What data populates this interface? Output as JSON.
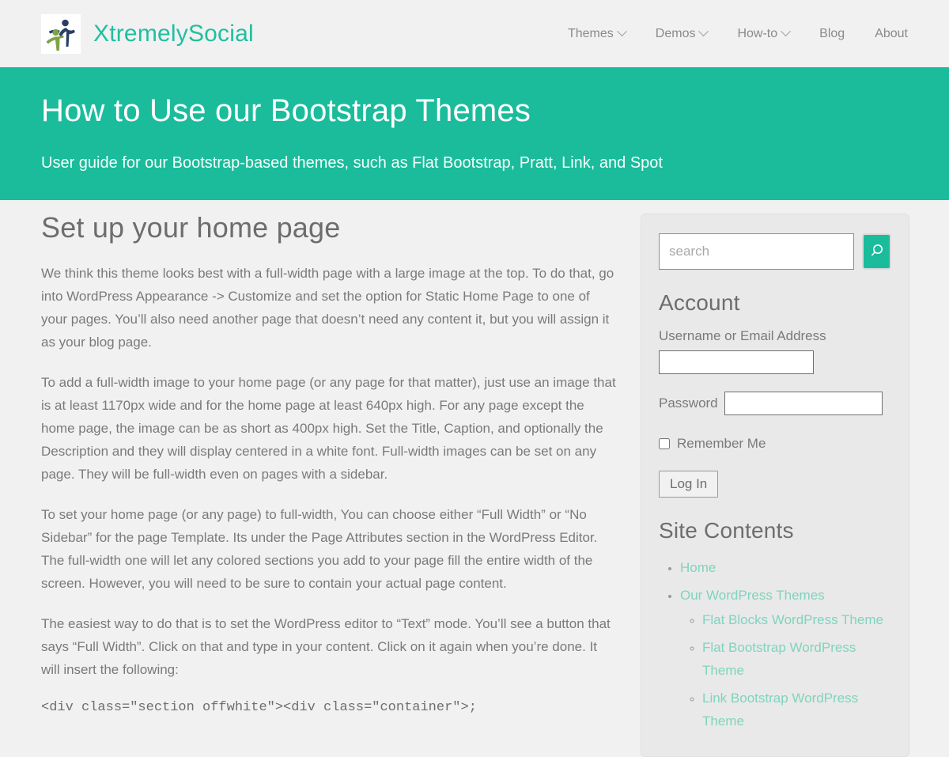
{
  "brand": {
    "name": "XtremelySocial",
    "logo_icon": "two-figures-logo-icon"
  },
  "nav": {
    "items": [
      {
        "label": "Themes",
        "has_dropdown": true
      },
      {
        "label": "Demos",
        "has_dropdown": true
      },
      {
        "label": "How-to",
        "has_dropdown": true
      },
      {
        "label": "Blog",
        "has_dropdown": false
      },
      {
        "label": "About",
        "has_dropdown": false
      }
    ]
  },
  "hero": {
    "title": "How to Use our Bootstrap Themes",
    "subtitle": "User guide for our Bootstrap-based themes, such as Flat Bootstrap, Pratt, Link, and Spot",
    "background_color": "#1abc9c"
  },
  "content": {
    "title": "Set up your home page",
    "paragraphs": [
      "We think this theme looks best with a full-width page with a large image at the top. To do that, go into WordPress Appearance -> Customize and set the option for Static Home Page to one of your pages. You’ll also need another page that doesn’t need any content it, but you will assign it as your blog page.",
      "To add a full-width image to your home page (or any page for that matter), just use an image that is at least 1170px wide and for the home page at least 640px high. For any page except the home page, the image can be as short as 400px high. Set the Title, Caption, and optionally the Description and they will display centered in a white font. Full-width images can be set on any page. They will be full-width even on pages with a sidebar.",
      "To set your home page (or any page) to full-width, You can choose either “Full Width” or “No Sidebar” for the page Template. Its under the Page Attributes section in the WordPress Editor. The full-width one will let any colored sections you add to your page fill the entire width of the screen. However, you will need to be sure to contain your actual page content.",
      "The easiest way to do that is to set the WordPress editor to “Text” mode. You’ll see a button that says “Full Width”. Click on that and type in your content. Click on it again when you’re done. It will insert the following:"
    ],
    "code": "<div class=\"section offwhite\"><div class=\"container\">;"
  },
  "sidebar": {
    "search": {
      "placeholder": "search",
      "value": "",
      "button_icon": "search-icon"
    },
    "account": {
      "title": "Account",
      "username_label": "Username or Email Address",
      "username_value": "",
      "password_label": "Password",
      "password_value": "",
      "remember_label": "Remember Me",
      "remember_checked": false,
      "login_label": "Log In"
    },
    "site_contents": {
      "title": "Site Contents",
      "items": [
        {
          "label": "Home",
          "children": []
        },
        {
          "label": "Our WordPress Themes",
          "children": [
            {
              "label": "Flat Blocks WordPress Theme"
            },
            {
              "label": "Flat Bootstrap WordPress Theme"
            },
            {
              "label": "Link Bootstrap WordPress Theme"
            }
          ]
        }
      ]
    },
    "link_color": "#7fd4bd"
  }
}
